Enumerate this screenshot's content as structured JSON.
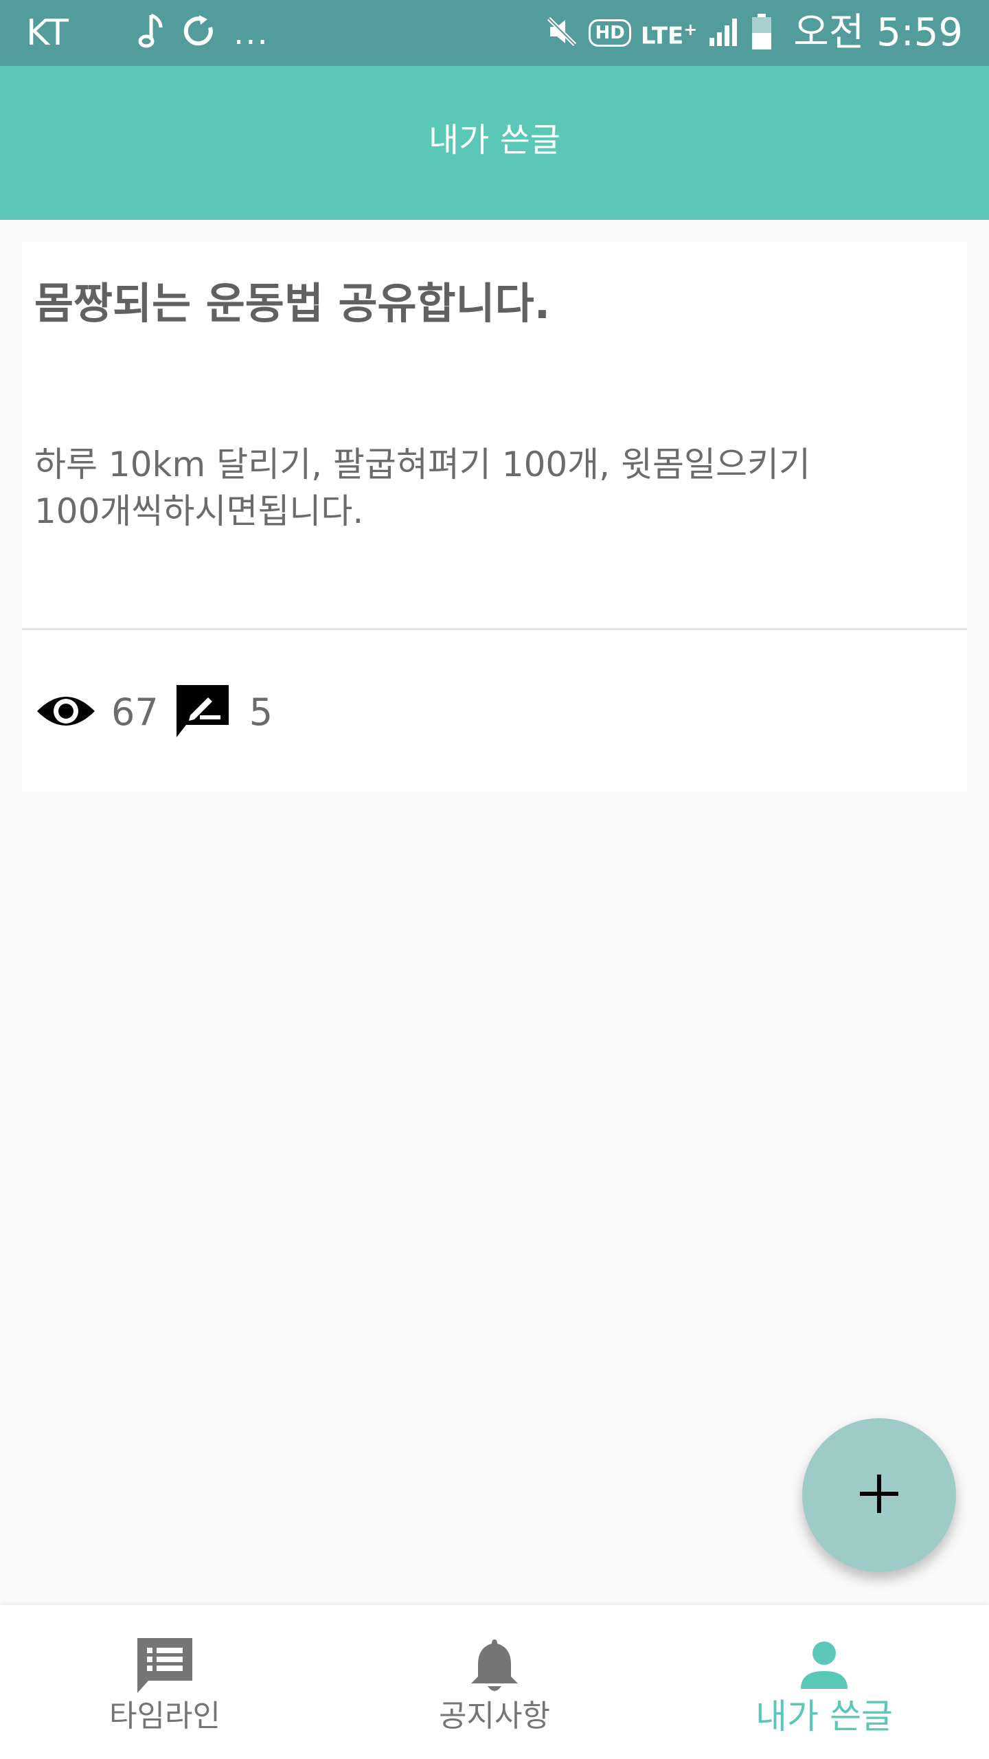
{
  "status_bar": {
    "carrier": "KT",
    "dots": "...",
    "hd": "HD",
    "lte": "LTE",
    "lte_plus": "+",
    "time": "오전 5:59"
  },
  "app_bar": {
    "title": "내가 쓴글"
  },
  "post": {
    "title": "몸짱되는 운동법 공유합니다.",
    "body_line1": "하루 10km 달리기, 팔굽혀펴기 100개, 윗몸일으키기",
    "body_line2": "100개씩하시면됩니다.",
    "views": "67",
    "comments": "5"
  },
  "fab": {
    "icon": "plus-icon"
  },
  "bottom_nav": {
    "items": [
      {
        "label": "타임라인",
        "icon": "timeline-icon",
        "active": false
      },
      {
        "label": "공지사항",
        "icon": "bell-icon",
        "active": false
      },
      {
        "label": "내가 쓴글",
        "icon": "person-icon",
        "active": true
      }
    ]
  },
  "colors": {
    "status_bar": "#529c9c",
    "app_bar": "#5bc8b7",
    "fab": "#9ecbc7",
    "active_tab": "#5bc8b7",
    "inactive_tab": "#757575"
  }
}
